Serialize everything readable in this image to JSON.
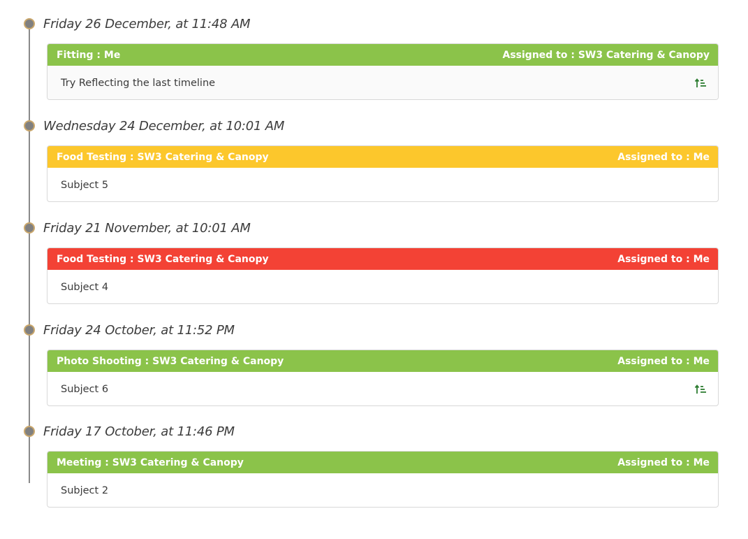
{
  "colors": {
    "green": "#8bc34a",
    "amber": "#fcc72c",
    "red": "#f34235"
  },
  "entries": [
    {
      "date": "Friday 26 December, at 11:48 AM",
      "header_left": "Fitting : Me",
      "header_right": "Assigned to : SW3 Catering & Canopy",
      "status_color": "#8bc34a",
      "subject": "Try Reflecting the last timeline",
      "icon": "sort-ascending-icon"
    },
    {
      "date": "Wednesday 24 December, at 10:01 AM",
      "header_left": "Food Testing : SW3 Catering & Canopy",
      "header_right": "Assigned to : Me",
      "status_color": "#fcc72c",
      "subject": "Subject 5",
      "icon": ""
    },
    {
      "date": "Friday 21 November, at 10:01 AM",
      "header_left": "Food Testing : SW3 Catering & Canopy",
      "header_right": "Assigned to : Me",
      "status_color": "#f34235",
      "subject": "Subject 4",
      "icon": ""
    },
    {
      "date": "Friday 24 October, at 11:52 PM",
      "header_left": "Photo Shooting : SW3 Catering & Canopy",
      "header_right": "Assigned to : Me",
      "status_color": "#8bc34a",
      "subject": "Subject 6",
      "icon": "sort-ascending-icon"
    },
    {
      "date": "Friday 17 October, at 11:46 PM",
      "header_left": "Meeting : SW3 Catering & Canopy",
      "header_right": "Assigned to : Me",
      "status_color": "#8bc34a",
      "subject": "Subject 2",
      "icon": ""
    }
  ]
}
